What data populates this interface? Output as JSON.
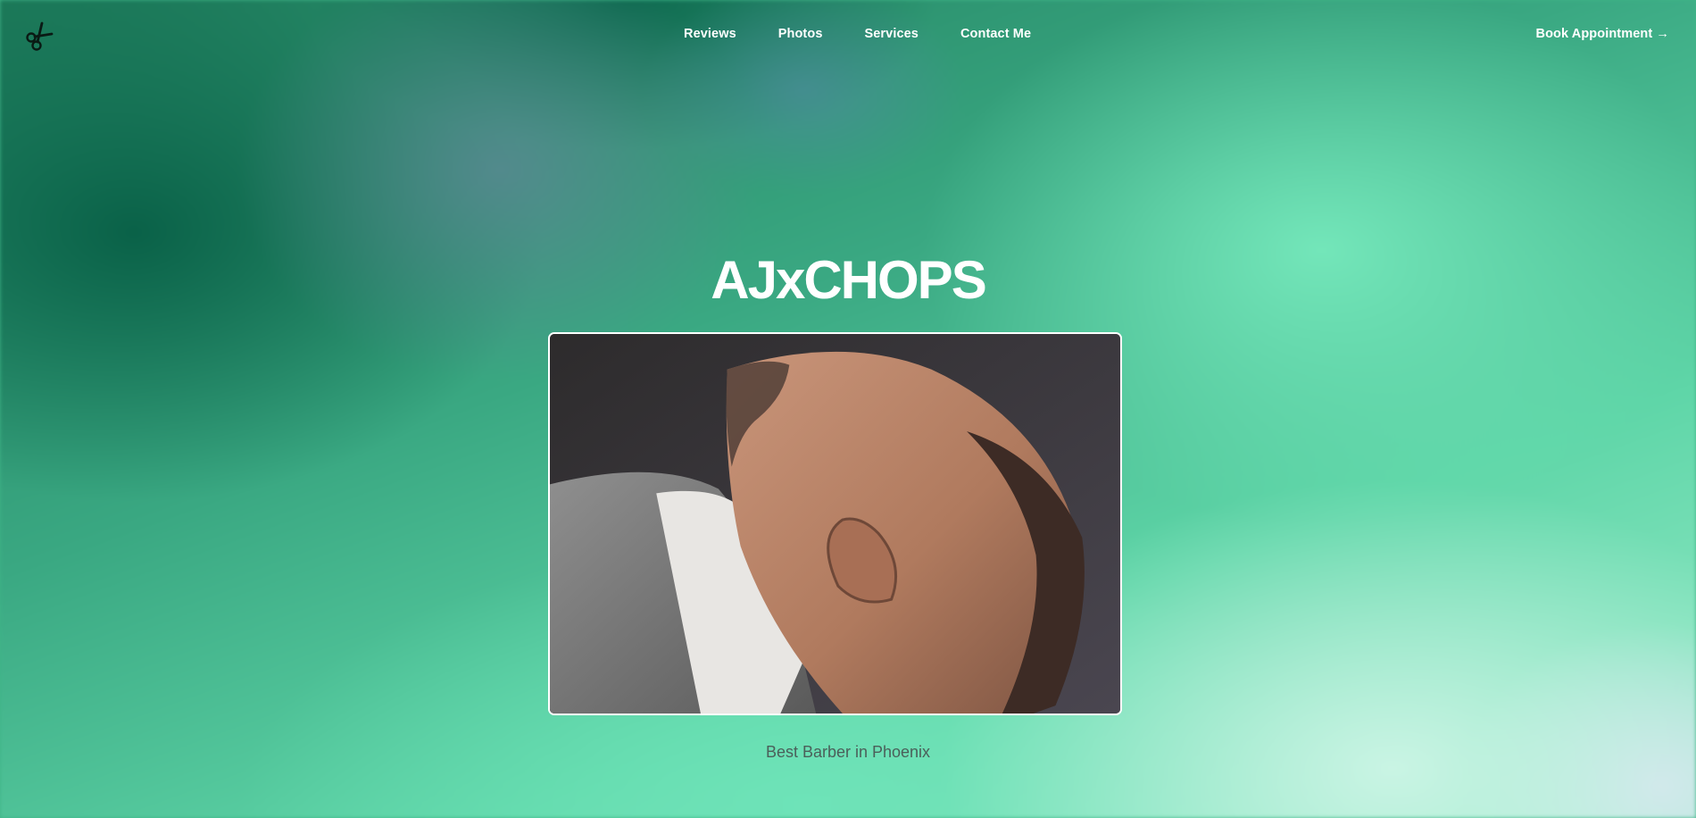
{
  "header": {
    "logo_icon": "scissors-icon",
    "nav": [
      {
        "label": "Reviews"
      },
      {
        "label": "Photos"
      },
      {
        "label": "Services"
      },
      {
        "label": "Contact Me"
      }
    ],
    "cta_label": "Book Appointment →"
  },
  "hero": {
    "title": "AJxCHOPS",
    "image_subject": "barber-client-profile-photo",
    "tagline": "Best Barber in Phoenix"
  },
  "colors": {
    "background_dark": "#0e6b4e",
    "background_mid": "#3fb487",
    "background_light": "#9beccb",
    "text_primary": "#ffffff",
    "tagline": "#4b5f5a"
  }
}
